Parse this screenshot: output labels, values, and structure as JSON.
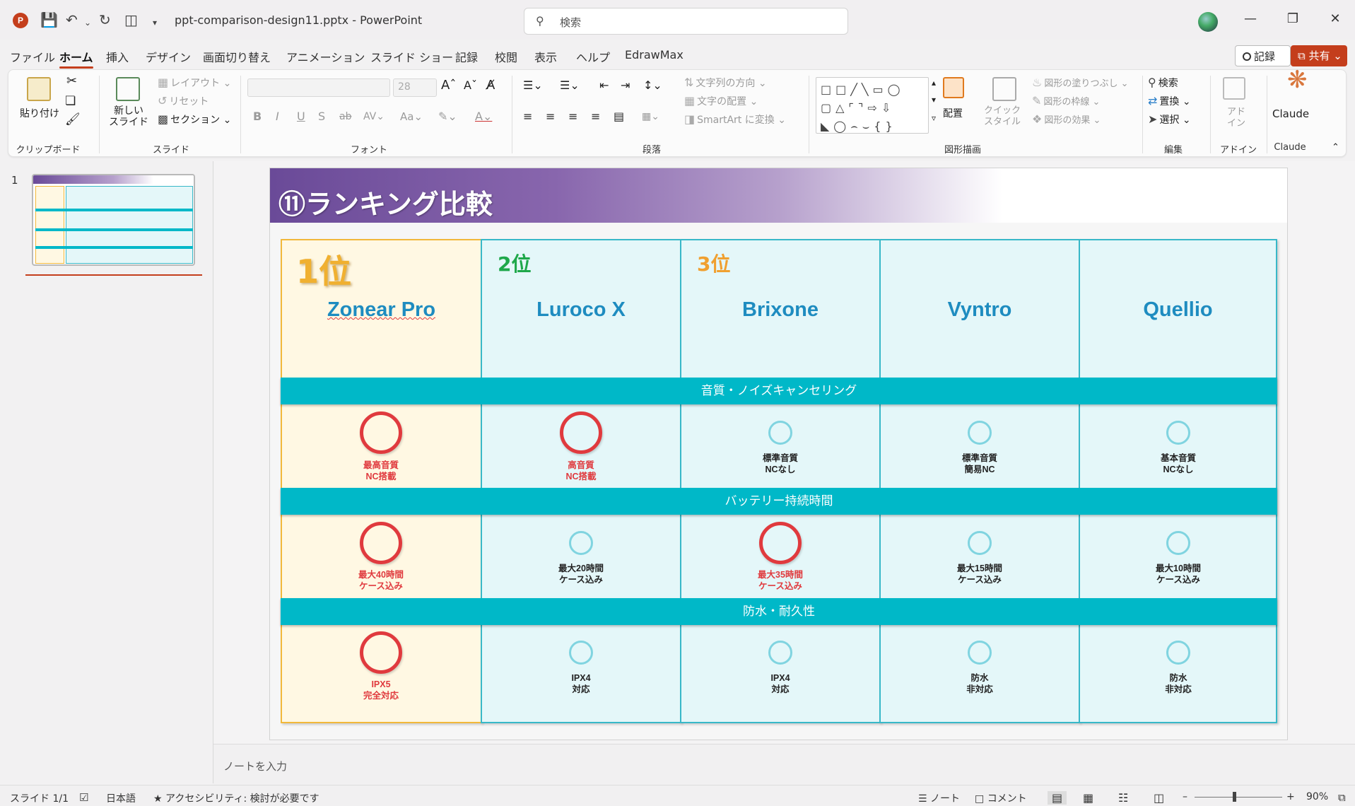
{
  "app": {
    "title": "ppt-comparison-design11.pptx  -  PowerPoint",
    "logo_letter": "P"
  },
  "search": {
    "placeholder": "検索"
  },
  "menu_tabs": [
    "ファイル",
    "ホーム",
    "挿入",
    "デザイン",
    "画面切り替え",
    "アニメーション",
    "スライド ショー",
    "記録",
    "校閲",
    "表示",
    "ヘルプ",
    "EdrawMax"
  ],
  "record_label": "記録",
  "share_label": "共有",
  "ribbon": {
    "groups": [
      "クリップボード",
      "スライド",
      "フォント",
      "段落",
      "図形描画",
      "編集",
      "アドイン",
      "Claude"
    ],
    "paste": "貼り付け",
    "new_slide": "新しい\nスライド",
    "layout": "レイアウト",
    "reset": "リセット",
    "section": "セクション",
    "font_size": "28",
    "text_direction": "文字列の方向",
    "align_text": "文字の配置",
    "smartart": "SmartArt に変換",
    "arrange": "配置",
    "quick_style": "クイック\nスタイル",
    "shape_fill": "図形の塗りつぶし",
    "shape_outline": "図形の枠線",
    "shape_effect": "図形の効果",
    "find": "検索",
    "replace": "置換",
    "select": "選択",
    "addin": "アド\nイン",
    "claude": "Claude"
  },
  "thumbnail": {
    "number": "1"
  },
  "slide": {
    "title": "⑪ランキング比較",
    "columns": [
      {
        "rank": "1位",
        "name": "Zonear Pro"
      },
      {
        "rank": "2位",
        "name": "Luroco X"
      },
      {
        "rank": "3位",
        "name": "Brixone"
      },
      {
        "rank": "",
        "name": "Vyntro"
      },
      {
        "rank": "",
        "name": "Quellio"
      }
    ],
    "sections": [
      {
        "label": "音質・ノイズキャンセリング",
        "cells": [
          {
            "mark": "big",
            "line1": "最高音質",
            "line2": "NC搭載"
          },
          {
            "mark": "big",
            "line1": "高音質",
            "line2": "NC搭載"
          },
          {
            "mark": "small",
            "line1": "標準音質",
            "line2": "NCなし"
          },
          {
            "mark": "small",
            "line1": "標準音質",
            "line2": "簡易NC"
          },
          {
            "mark": "small",
            "line1": "基本音質",
            "line2": "NCなし"
          }
        ]
      },
      {
        "label": "バッテリー持続時間",
        "cells": [
          {
            "mark": "big",
            "line1": "最大40時間",
            "line2": "ケース込み"
          },
          {
            "mark": "small",
            "line1": "最大20時間",
            "line2": "ケース込み"
          },
          {
            "mark": "big",
            "line1": "最大35時間",
            "line2": "ケース込み"
          },
          {
            "mark": "small",
            "line1": "最大15時間",
            "line2": "ケース込み"
          },
          {
            "mark": "small",
            "line1": "最大10時間",
            "line2": "ケース込み"
          }
        ]
      },
      {
        "label": "防水・耐久性",
        "cells": [
          {
            "mark": "big",
            "line1": "IPX5",
            "line2": "完全対応"
          },
          {
            "mark": "small",
            "line1": "IPX4",
            "line2": "対応"
          },
          {
            "mark": "small",
            "line1": "IPX4",
            "line2": "対応"
          },
          {
            "mark": "small",
            "line1": "防水",
            "line2": "非対応"
          },
          {
            "mark": "small",
            "line1": "防水",
            "line2": "非対応"
          }
        ]
      }
    ],
    "colors": {
      "rank1": "#f0b030",
      "rank2": "#1ea84a",
      "rank3": "#f0a030",
      "accent_red": "#e03a3e",
      "band": "#00b8c8"
    }
  },
  "notes_placeholder": "ノートを入力",
  "status": {
    "slide_count": "スライド 1/1",
    "language": "日本語",
    "accessibility": "アクセシビリティ: 検討が必要です",
    "notes": "ノート",
    "comments": "コメント",
    "zoom": "90%"
  }
}
